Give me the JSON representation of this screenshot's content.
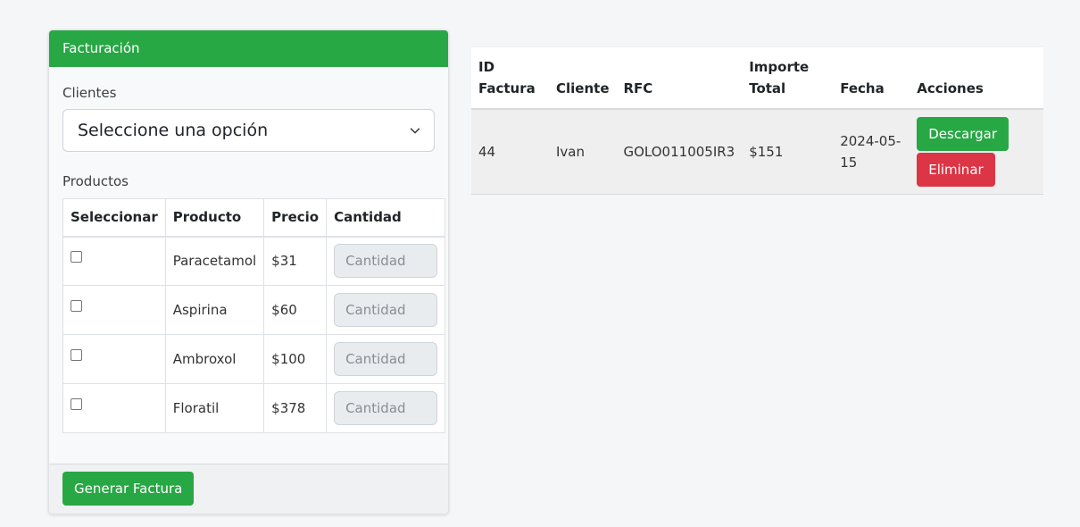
{
  "card": {
    "title": "Facturación",
    "clients_label": "Clientes",
    "clients_select_value": "Seleccione una opción",
    "products_label": "Productos",
    "product_columns": [
      "Seleccionar",
      "Producto",
      "Precio",
      "Cantidad"
    ],
    "quantity_placeholder": "Cantidad",
    "products": [
      {
        "name": "Paracetamol",
        "price": "$31"
      },
      {
        "name": "Aspirina",
        "price": "$60"
      },
      {
        "name": "Ambroxol",
        "price": "$100"
      },
      {
        "name": "Floratil",
        "price": "$378"
      }
    ],
    "generate_button": "Generar Factura"
  },
  "invoices": {
    "columns": {
      "id_line1": "ID",
      "id_line2": "Factura",
      "cliente": "Cliente",
      "rfc": "RFC",
      "importe_line1": "Importe",
      "importe_line2": "Total",
      "fecha": "Fecha",
      "acciones": "Acciones"
    },
    "rows": [
      {
        "id": "44",
        "cliente": "Ivan",
        "rfc": "GOLO011005IR3",
        "importe": "$151",
        "fecha": "2024-05-15",
        "download_label": "Descargar",
        "delete_label": "Eliminar"
      }
    ]
  },
  "colors": {
    "accent_green": "#28a745",
    "danger_red": "#dc3545"
  },
  "icons": {
    "select_chevron": "chevron-down-icon"
  }
}
